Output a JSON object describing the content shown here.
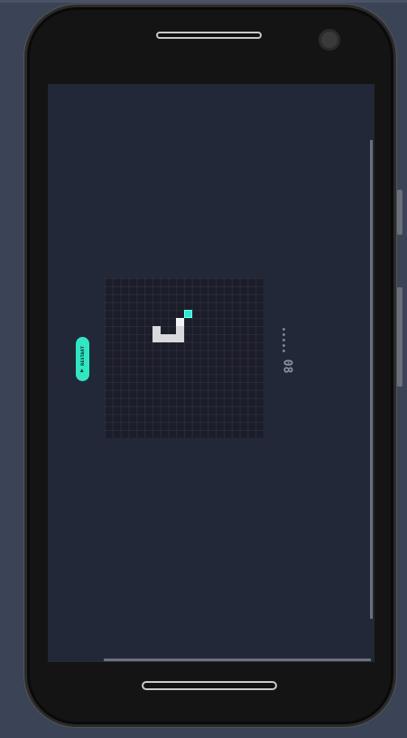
{
  "game": {
    "restart_label": "RESTART",
    "score": "08",
    "dots_count": 5
  },
  "board": {
    "grid": [
      20,
      20
    ],
    "food": [
      10,
      4
    ],
    "snake": [
      [
        9,
        7
      ],
      [
        8,
        7
      ],
      [
        7,
        7
      ],
      [
        6,
        7
      ],
      [
        6,
        6
      ],
      [
        9,
        6
      ],
      [
        9,
        5
      ]
    ]
  },
  "colors": {
    "accent": "#2ee8c4",
    "food": "#1ff0d2",
    "snake": "#d9d9dd",
    "screen_bg": "#232838",
    "board_bg": "#1c1d2a"
  },
  "icons": {
    "restart": "play-icon"
  }
}
